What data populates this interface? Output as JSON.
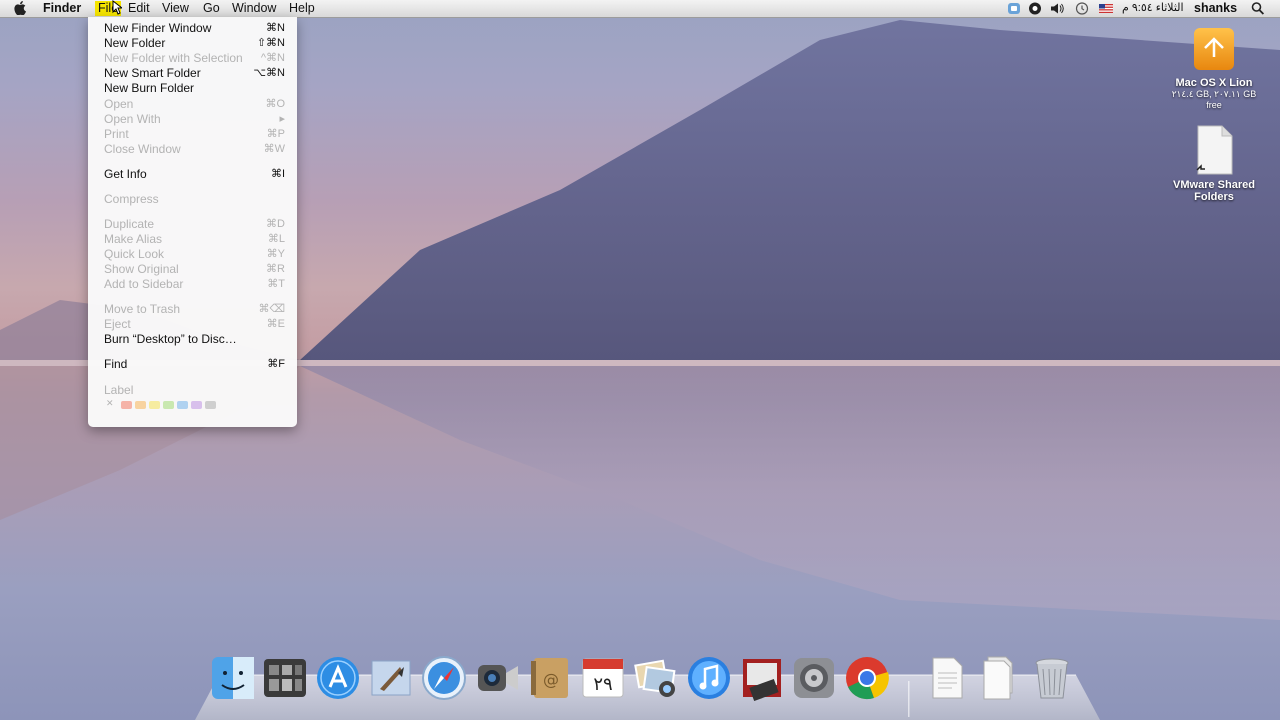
{
  "menubar": {
    "app": "Finder",
    "items": [
      "File",
      "Edit",
      "View",
      "Go",
      "Window",
      "Help"
    ],
    "clock": "الثلاثاء ٩:٥٤ م",
    "user": "shanks",
    "icons": [
      "apple-icon",
      "vmware-icon",
      "record-icon",
      "volume-icon",
      "time-machine-icon",
      "us-flag-icon",
      "spotlight-icon"
    ]
  },
  "file_menu": {
    "items": [
      {
        "label": "New Finder Window",
        "shortcut": "⌘N",
        "enabled": true
      },
      {
        "label": "New Folder",
        "shortcut": "⇧⌘N",
        "enabled": true
      },
      {
        "label": "New Folder with Selection",
        "shortcut": "^⌘N",
        "enabled": false
      },
      {
        "label": "New Smart Folder",
        "shortcut": "⌥⌘N",
        "enabled": true
      },
      {
        "label": "New Burn Folder",
        "shortcut": "",
        "enabled": true
      },
      {
        "label": "Open",
        "shortcut": "⌘O",
        "enabled": false
      },
      {
        "label": "Open With",
        "shortcut": "▸",
        "enabled": false
      },
      {
        "label": "Print",
        "shortcut": "⌘P",
        "enabled": false
      },
      {
        "label": "Close Window",
        "shortcut": "⌘W",
        "enabled": false
      },
      {
        "label": "Get Info",
        "shortcut": "⌘I",
        "enabled": true
      },
      {
        "label": "Compress",
        "shortcut": "",
        "enabled": false
      },
      {
        "label": "Duplicate",
        "shortcut": "⌘D",
        "enabled": false
      },
      {
        "label": "Make Alias",
        "shortcut": "⌘L",
        "enabled": false
      },
      {
        "label": "Quick Look",
        "shortcut": "⌘Y",
        "enabled": false
      },
      {
        "label": "Show Original",
        "shortcut": "⌘R",
        "enabled": false
      },
      {
        "label": "Add to Sidebar",
        "shortcut": "⌘T",
        "enabled": false
      },
      {
        "label": "Move to Trash",
        "shortcut": "⌘⌫",
        "enabled": false
      },
      {
        "label": "Eject",
        "shortcut": "⌘E",
        "enabled": false
      },
      {
        "label": "Burn “Desktop” to Disc…",
        "shortcut": "",
        "enabled": true
      },
      {
        "label": "Find",
        "shortcut": "⌘F",
        "enabled": true
      }
    ],
    "label_title": "Label",
    "label_colors": [
      "#c8c8c8",
      "#f5b3a8",
      "#f8d3a0",
      "#f6eca0",
      "#c9e8b0",
      "#b0d2f0",
      "#d8c0ec",
      "#cfcfcf"
    ]
  },
  "desktop": {
    "icons": [
      {
        "name": "Mac OS X Lion",
        "sub": "٢١٤.٤ GB, ٢٠٧.١١ GB free"
      },
      {
        "name": "VMware Shared Folders",
        "sub": ""
      }
    ]
  },
  "dock": {
    "icons": [
      "finder-icon",
      "dashboard-icon",
      "app-store-icon",
      "mail-icon",
      "safari-icon",
      "facetime-icon",
      "address-book-icon",
      "calendar-icon",
      "photo-booth-icon",
      "itunes-icon",
      "photo-slideshow-icon",
      "system-preferences-icon",
      "chrome-icon",
      "document-icon",
      "document-stack-icon",
      "trash-icon"
    ],
    "calendar_day": "٢٩"
  },
  "colors": {
    "highlight": "#f5e400",
    "disabled_text": "#b3b3b3"
  }
}
